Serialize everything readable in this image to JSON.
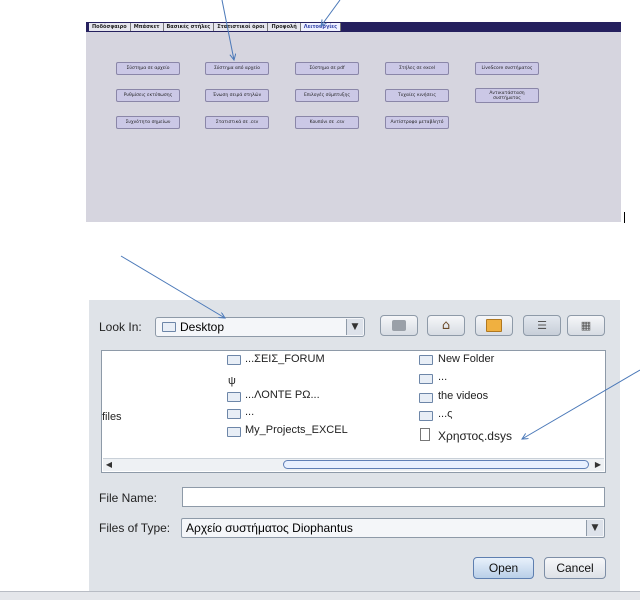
{
  "top_panel": {
    "tabs": [
      "Ποδόσφαιρο",
      "Μπάσκετ",
      "Βασικές στήλες",
      "Στατιστικοί όροι",
      "Προφολή",
      "Λειτουργίες"
    ],
    "buttons": [
      "Σύστημα σε αρχείο",
      "Σύστημα από αρχείο",
      "Σύστημα σε pdf",
      "Στήλες σε excel",
      "LiveScore συστήματος",
      "Ρυθμίσεις εκτύπωσης",
      "Ένωση σειρά στηλών",
      "Επιλογές σύμπτυξης",
      "Τυχαίες κινήσεις",
      "Αντικατάσταση συστήματος",
      "Συχνότητα σημείων",
      "Στατιστικά σε .csv",
      "Κουπόνι σε .csv",
      "Αντίστροφο μεταβλητό"
    ]
  },
  "dialog": {
    "look_in_label": "Look In:",
    "look_in_value": "Desktop",
    "toolbar_icons": [
      "up-folder-icon",
      "home-icon",
      "new-folder-icon",
      "list-view-icon",
      "details-view-icon"
    ],
    "files_col1": [
      "...ΣΕΙΣ_FORUM",
      "ψ",
      "...ΛΟΝΤΕ ΡΩ...",
      "...",
      "My_Projects_EXCEL"
    ],
    "files_col2": [
      "New Folder",
      "...",
      "the videos",
      "...ς",
      "Χρηστος.dsys"
    ],
    "left_partial": "files",
    "file_name_label": "File Name:",
    "file_name_value": "",
    "files_of_type_label": "Files of Type:",
    "files_of_type_value": "Αρχείο συστήματος Diophantus",
    "open_label": "Open",
    "cancel_label": "Cancel"
  },
  "colors": {
    "panel_bg": "#d6d5df",
    "menu_strip": "#25205e",
    "button_bg": "#cbc8e6",
    "dialog_bg": "#dfe3e8",
    "annotation_arrow": "#4a78b8"
  }
}
